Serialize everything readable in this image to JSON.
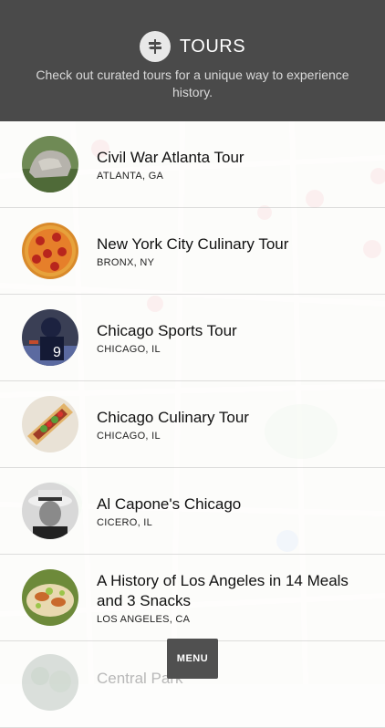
{
  "header": {
    "title": "TOURS",
    "subtitle": "Check out curated tours for a unique way to experience history.",
    "icon": "signpost-icon"
  },
  "tours": [
    {
      "title": "Civil War Atlanta Tour",
      "location": "ATLANTA, GA",
      "thumb": "statue"
    },
    {
      "title": "New York City Culinary Tour",
      "location": "BRONX, NY",
      "thumb": "pizza"
    },
    {
      "title": "Chicago Sports Tour",
      "location": "CHICAGO, IL",
      "thumb": "football"
    },
    {
      "title": "Chicago Culinary Tour",
      "location": "CHICAGO, IL",
      "thumb": "hotdog"
    },
    {
      "title": "Al Capone's Chicago",
      "location": "CICERO, IL",
      "thumb": "portrait"
    },
    {
      "title": "A History of Los Angeles in 14 Meals and 3 Snacks",
      "location": "LOS ANGELES, CA",
      "thumb": "tacos"
    },
    {
      "title": "Central Park",
      "location": "",
      "thumb": "park"
    }
  ],
  "menu": {
    "label": "MENU"
  },
  "colors": {
    "header_bg": "#4a4a4a",
    "menu_bg": "#505050",
    "map_pin": "#e8545a"
  }
}
